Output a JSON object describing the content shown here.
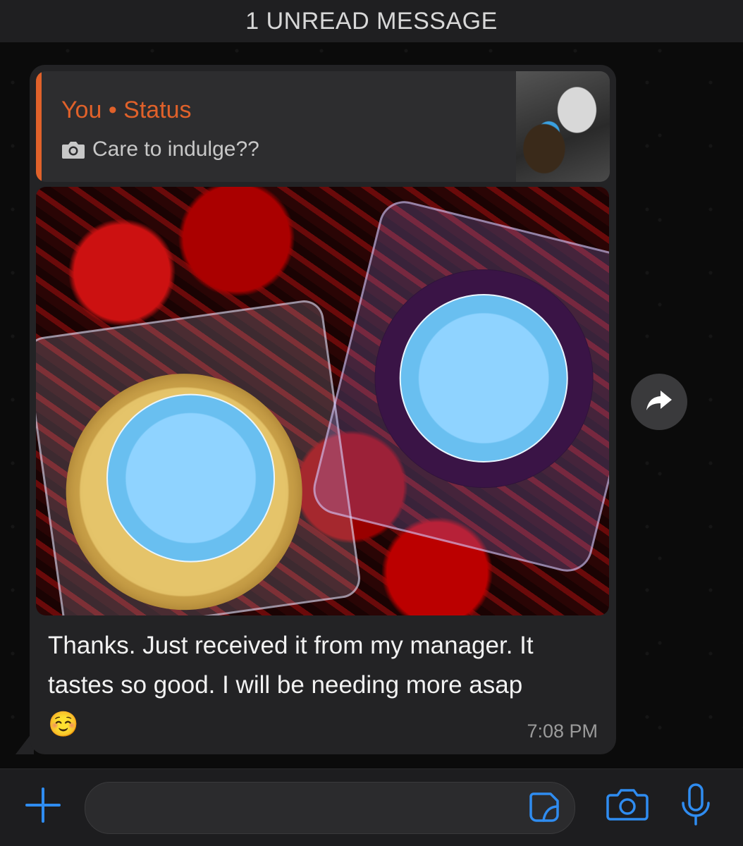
{
  "banner": {
    "unread_label": "1 UNREAD MESSAGE"
  },
  "message": {
    "quote": {
      "author": "You • Status",
      "text": "Care to indulge??",
      "icon": "camera-icon"
    },
    "text": "Thanks. Just received it from my manager. It tastes so good. I will be needing more asap ☺️",
    "time": "7:08 PM"
  },
  "actions": {
    "forward_icon": "forward-arrow-icon"
  },
  "input_bar": {
    "attach_icon": "plus-icon",
    "sticker_icon": "sticker-icon",
    "camera_icon": "camera-icon",
    "mic_icon": "microphone-icon",
    "text_value": ""
  },
  "colors": {
    "accent": "#2f8cf0",
    "quote_accent": "#e0612a",
    "bubble": "#232325",
    "background": "#0b0b0b"
  }
}
